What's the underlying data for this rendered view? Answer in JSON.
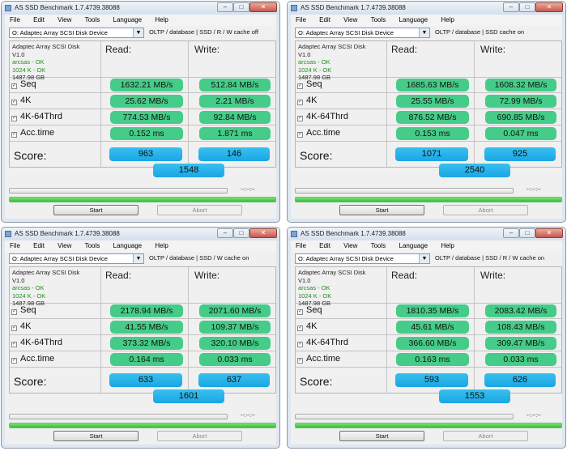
{
  "windows": [
    {
      "title": "AS SSD Benchmark 1.7.4739.38088",
      "menu": [
        "File",
        "Edit",
        "View",
        "Tools",
        "Language",
        "Help"
      ],
      "drive": "O: Adaptec Array SCSI Disk Device",
      "config": "OLTP / database | SSD / R / W cache off",
      "info": {
        "name": "Adaptec Array SCSI Disk",
        "version": "V1.0",
        "driver": "arcsas - OK",
        "align": "1024 K - OK",
        "size": "1487.98 GB"
      },
      "headers": {
        "read": "Read:",
        "write": "Write:"
      },
      "rows": [
        {
          "label": "Seq",
          "read": "1632.21 MB/s",
          "write": "512.84 MB/s"
        },
        {
          "label": "4K",
          "read": "25.62 MB/s",
          "write": "2.21 MB/s"
        },
        {
          "label": "4K-64Thrd",
          "read": "774.53 MB/s",
          "write": "92.84 MB/s"
        },
        {
          "label": "Acc.time",
          "read": "0.152 ms",
          "write": "1.871 ms"
        }
      ],
      "score": {
        "label": "Score:",
        "read": "963",
        "write": "146",
        "total": "1548"
      },
      "time": "--:--:--",
      "buttons": {
        "start": "Start",
        "abort": "Abort"
      }
    },
    {
      "title": "AS SSD Benchmark 1.7.4739.38088",
      "menu": [
        "File",
        "Edit",
        "View",
        "Tools",
        "Language",
        "Help"
      ],
      "drive": "O: Adaptec Array SCSI Disk Device",
      "config": "OLTP / database | SSD cache on",
      "info": {
        "name": "Adaptec Array SCSI Disk",
        "version": "V1.0",
        "driver": "arcsas - OK",
        "align": "1024 K - OK",
        "size": "1487.98 GB"
      },
      "headers": {
        "read": "Read:",
        "write": "Write:"
      },
      "rows": [
        {
          "label": "Seq",
          "read": "1685.63 MB/s",
          "write": "1608.32 MB/s"
        },
        {
          "label": "4K",
          "read": "25.55 MB/s",
          "write": "72.99 MB/s"
        },
        {
          "label": "4K-64Thrd",
          "read": "876.52 MB/s",
          "write": "690.85 MB/s"
        },
        {
          "label": "Acc.time",
          "read": "0.153 ms",
          "write": "0.047 ms"
        }
      ],
      "score": {
        "label": "Score:",
        "read": "1071",
        "write": "925",
        "total": "2540"
      },
      "time": "--:--:--",
      "buttons": {
        "start": "Start",
        "abort": "Abort"
      }
    },
    {
      "title": "AS SSD Benchmark 1.7.4739.38088",
      "menu": [
        "File",
        "Edit",
        "View",
        "Tools",
        "Language",
        "Help"
      ],
      "drive": "O: Adaptec Array SCSI Disk Device",
      "config": "OLTP / database | SSD / W cache on",
      "info": {
        "name": "Adaptec Array SCSI Disk",
        "version": "V1.0",
        "driver": "arcsas - OK",
        "align": "1024 K - OK",
        "size": "1487.98 GB"
      },
      "headers": {
        "read": "Read:",
        "write": "Write:"
      },
      "rows": [
        {
          "label": "Seq",
          "read": "2178.94 MB/s",
          "write": "2071.60 MB/s"
        },
        {
          "label": "4K",
          "read": "41.55 MB/s",
          "write": "109.37 MB/s"
        },
        {
          "label": "4K-64Thrd",
          "read": "373.32 MB/s",
          "write": "320.10 MB/s"
        },
        {
          "label": "Acc.time",
          "read": "0.164 ms",
          "write": "0.033 ms"
        }
      ],
      "score": {
        "label": "Score:",
        "read": "633",
        "write": "637",
        "total": "1601"
      },
      "time": "--:--:--",
      "buttons": {
        "start": "Start",
        "abort": "Abort"
      }
    },
    {
      "title": "AS SSD Benchmark 1.7.4739.38088",
      "menu": [
        "File",
        "Edit",
        "View",
        "Tools",
        "Language",
        "Help"
      ],
      "drive": "O: Adaptec Array SCSI Disk Device",
      "config": "OLTP / database | SSD / R / W cache on",
      "info": {
        "name": "Adaptec Array SCSI Disk",
        "version": "V1.0",
        "driver": "arcsas - OK",
        "align": "1024 K - OK",
        "size": "1487.98 GB"
      },
      "headers": {
        "read": "Read:",
        "write": "Write:"
      },
      "rows": [
        {
          "label": "Seq",
          "read": "1810.35 MB/s",
          "write": "2083.42 MB/s"
        },
        {
          "label": "4K",
          "read": "45.61 MB/s",
          "write": "108.43 MB/s"
        },
        {
          "label": "4K-64Thrd",
          "read": "366.60 MB/s",
          "write": "309.47 MB/s"
        },
        {
          "label": "Acc.time",
          "read": "0.163 ms",
          "write": "0.033 ms"
        }
      ],
      "score": {
        "label": "Score:",
        "read": "593",
        "write": "626",
        "total": "1553"
      },
      "time": "--:--:--",
      "buttons": {
        "start": "Start",
        "abort": "Abort"
      }
    }
  ]
}
